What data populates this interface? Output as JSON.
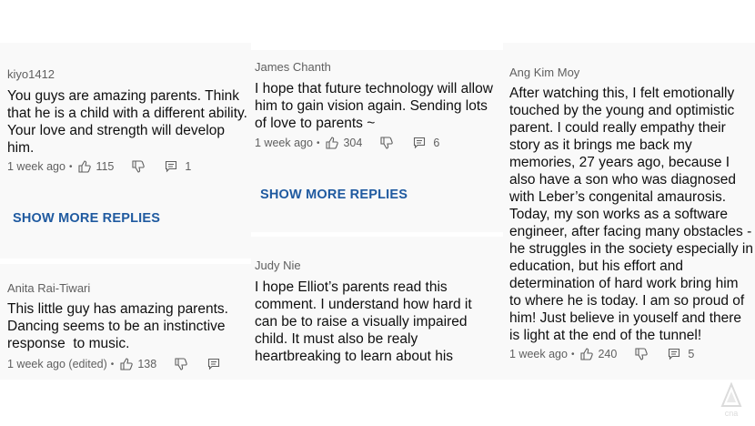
{
  "comments": [
    {
      "author": "kiyo1412",
      "lines": [
        "You guys are amazing parents. Think",
        "that he is a child with a different ability.",
        "Your love and strength will develop",
        "him."
      ],
      "time": "1 week ago",
      "likes": "115",
      "replies": "1"
    },
    {
      "author": "Anita Rai-Tiwari",
      "lines": [
        "This little guy has amazing parents.",
        "Dancing seems to be an instinctive",
        "response  to music."
      ],
      "time": "1 week ago (edited)",
      "likes": "138",
      "replies": ""
    },
    {
      "author": "James Chanth",
      "lines": [
        "I hope that future technology will allow",
        "him to gain vision again. Sending lots",
        "of love to parents ~"
      ],
      "time": "1 week ago",
      "likes": "304",
      "replies": "6"
    },
    {
      "author": "Judy Nie",
      "lines": [
        "I hope Elliot’s parents read this",
        "comment. I understand how hard it",
        "can be to raise a visually impaired",
        "child. It must also be realy",
        "heartbreaking to learn about his"
      ],
      "time": "",
      "likes": "",
      "replies": ""
    },
    {
      "author": "Ang Kim Moy",
      "lines": [
        "After watching this, I felt emotionally",
        "touched by the young and optimistic",
        "parent. I could really empathy their",
        "story as it brings me back my",
        "memories, 27 years ago, because I",
        "also have a son who was diagnosed",
        "with Leber’s congenital amaurosis.",
        "Today, my son works as a software",
        "engineer, after facing many obstacles -",
        "he struggles in the society especially in",
        "education, but his effort and",
        "determination of hard work bring him",
        "to where he is today. I am so proud of",
        "him! Just believe in youself and there",
        "is light at the end of the tunnel!"
      ],
      "time": "1 week ago",
      "likes": "240",
      "replies": "5"
    }
  ],
  "show_more_label": "SHOW MORE REPLIES",
  "watermark_text": "cna",
  "colors": {
    "link": "#1f5aa0",
    "meta": "#606060",
    "panel": "#f9f9f9"
  }
}
